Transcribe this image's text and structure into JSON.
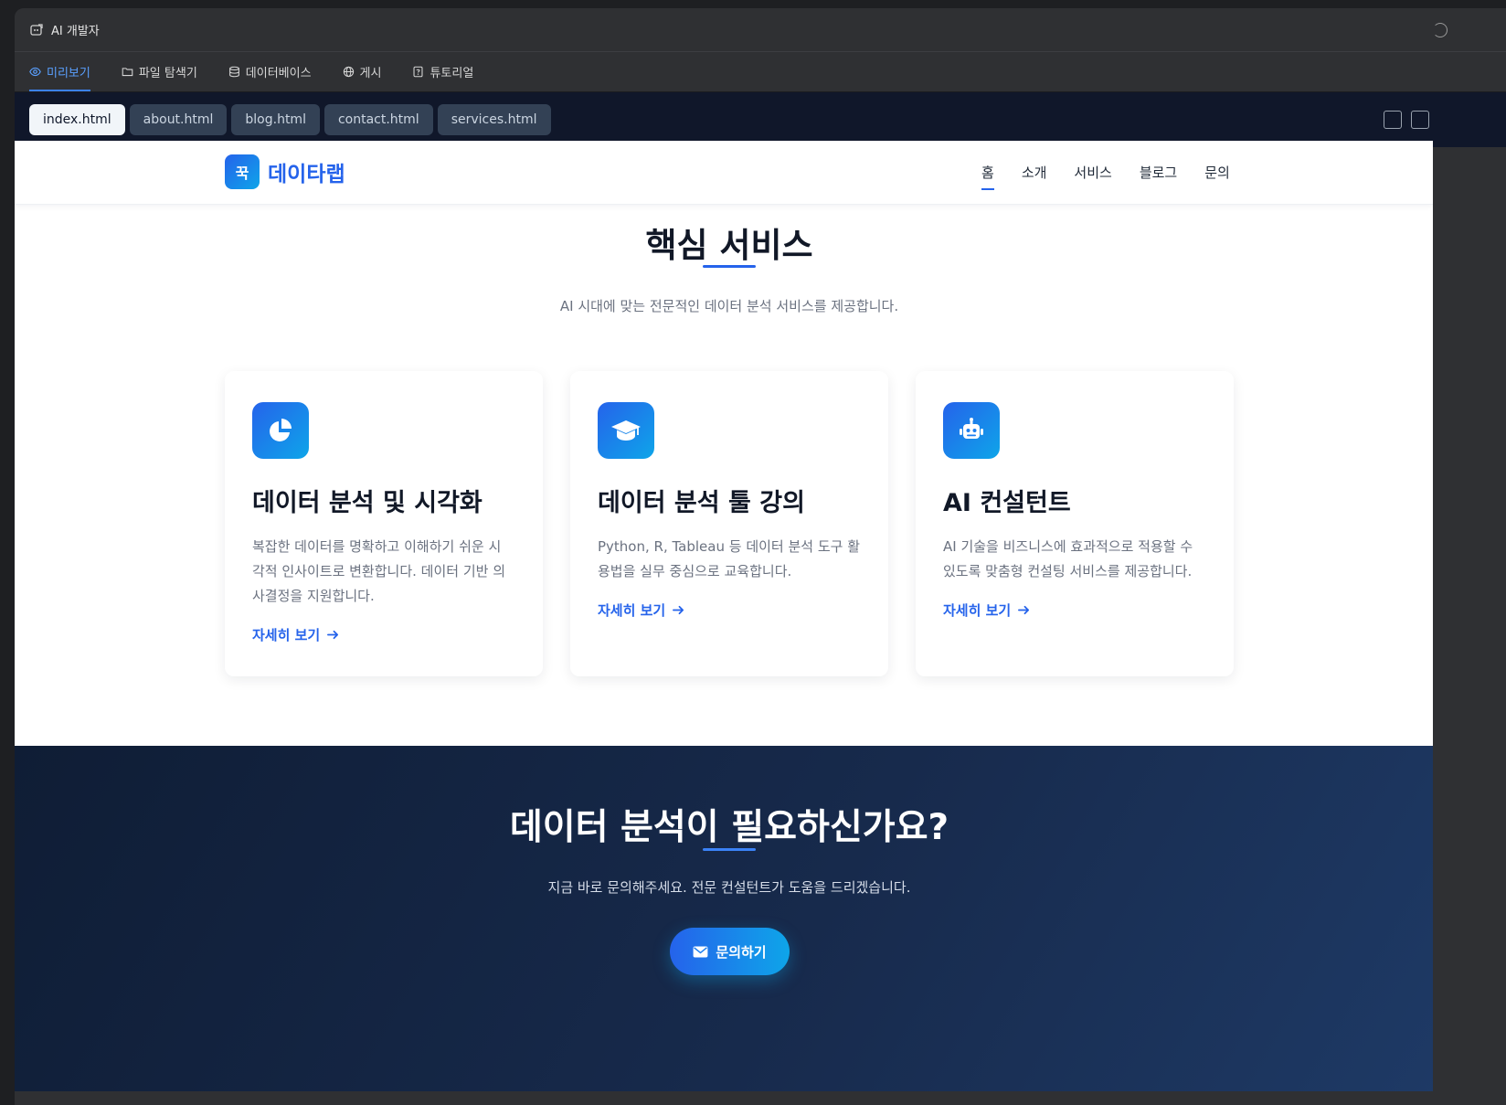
{
  "window": {
    "title": "AI 개발자"
  },
  "tabs": [
    {
      "label": "미리보기",
      "icon": "eye-icon",
      "active": true
    },
    {
      "label": "파일 탐색기",
      "icon": "folder-icon",
      "active": false
    },
    {
      "label": "데이터베이스",
      "icon": "database-icon",
      "active": false
    },
    {
      "label": "게시",
      "icon": "globe-icon",
      "active": false
    },
    {
      "label": "튜토리얼",
      "icon": "help-icon",
      "active": false
    }
  ],
  "files": [
    {
      "label": "index.html",
      "active": true
    },
    {
      "label": "about.html",
      "active": false
    },
    {
      "label": "blog.html",
      "active": false
    },
    {
      "label": "contact.html",
      "active": false
    },
    {
      "label": "services.html",
      "active": false
    }
  ],
  "site": {
    "logo_mark": "꾹",
    "logo_text": "데이타랩",
    "menu": [
      "홈",
      "소개",
      "서비스",
      "블로그",
      "문의"
    ],
    "section_title": "핵심 서비스",
    "section_sub": "AI 시대에 맞는 전문적인 데이터 분석 서비스를 제공합니다.",
    "cards": [
      {
        "icon": "pie-chart-icon",
        "title": "데이터 분석 및 시각화",
        "desc_lines": [
          "복잡한 데이터를 명확하고 이해하기 쉬운 시",
          "각적 인사이트로 변환합니다. 데이터 기반 의",
          "사결정을 지원합니다."
        ],
        "link": "자세히 보기"
      },
      {
        "icon": "graduation-cap-icon",
        "title": "데이터 분석 툴 강의",
        "desc_lines": [
          "Python, R, Tableau 등 데이터 분석 도구 활",
          "용법을 실무 중심으로 교육합니다."
        ],
        "link": "자세히 보기"
      },
      {
        "icon": "robot-icon",
        "title": "AI 컨설턴트",
        "desc_lines": [
          "AI 기술을 비즈니스에 효과적으로 적용할 수",
          "있도록 맞춤형 컨설팅 서비스를 제공합니다."
        ],
        "link": "자세히 보기"
      }
    ],
    "cta": {
      "title": "데이터 분석이 필요하신가요?",
      "sub": "지금 바로 문의해주세요. 전문 컨설턴트가 도움을 드리겠습니다.",
      "button": "문의하기"
    }
  },
  "colors": {
    "accent": "#2563eb",
    "accent2": "#0ea5e9",
    "cta_bg": "#172a4c"
  }
}
